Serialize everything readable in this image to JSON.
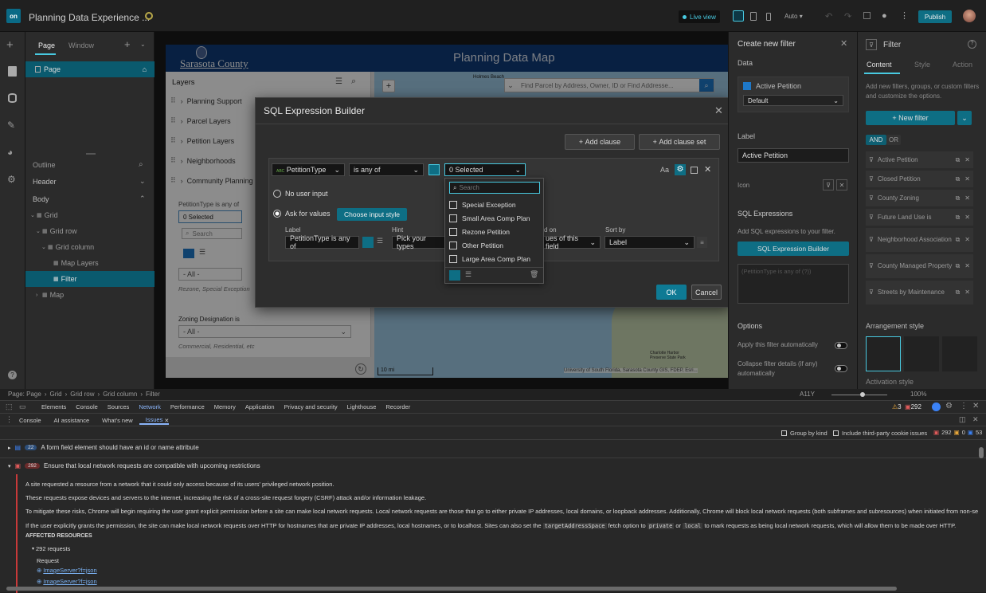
{
  "app": {
    "title": "Planning Data Experience ...",
    "live_view": "Live view",
    "auto": "Auto",
    "publish": "Publish"
  },
  "left": {
    "tabs": [
      "Page",
      "Window"
    ],
    "page_item": "Page",
    "outline": "Outline",
    "header": "Header",
    "body": "Body",
    "tree": [
      {
        "label": "Grid",
        "indent": 0,
        "arrow": "⌄"
      },
      {
        "label": "Grid row",
        "indent": 1,
        "arrow": "⌄"
      },
      {
        "label": "Grid column",
        "indent": 2,
        "arrow": "⌄"
      },
      {
        "label": "Map Layers",
        "indent": 3,
        "arrow": ""
      },
      {
        "label": "Filter",
        "indent": 3,
        "arrow": ""
      },
      {
        "label": "Map",
        "indent": 1,
        "arrow": "›"
      }
    ]
  },
  "map": {
    "org_name": "Sarasota County",
    "title": "Planning Data Map",
    "search_placeholder": "Find Parcel by Address, Owner, ID or Find Addresse...",
    "attribution": "University of South Florida, Sarasota County GIS, FDEP, Esri...",
    "scale": "10 mi",
    "place_holmes": "Holmes Beach",
    "place_charlotte": "Charlotte Harbor Preserve State Park"
  },
  "layers": {
    "title": "Layers",
    "items": [
      "Planning Support",
      "Parcel Layers",
      "Petition Layers",
      "Neighborhoods",
      "Community Planning"
    ],
    "petition_label": "PetitionType is any of",
    "petition_value": "0 Selected",
    "search": "Search",
    "all_value": "- All -",
    "rezone_hint": "Rezone, Special Exception",
    "zoning_label": "Zoning Designation is",
    "zoning_value": "- All -",
    "zoning_hint": "Commercial, Residential, etc"
  },
  "dialog": {
    "title": "SQL Expression Builder",
    "add_clause": "Add clause",
    "add_clause_set": "Add clause set",
    "field": "PetitionType",
    "operator": "is any of",
    "values": "0 Selected",
    "no_user_input": "No user input",
    "ask_for_values": "Ask for values",
    "choose_style": "Choose input style",
    "label_hdr": "Label",
    "hint_hdr": "Hint",
    "based_on_hdr": "d on",
    "sort_hdr": "Sort by",
    "label_value": "PetitionType is any of",
    "hint_value": "Pick your types",
    "based_on_value": "ues of this field",
    "sort_value": "Label",
    "ok": "OK",
    "cancel": "Cancel",
    "dropdown": {
      "search_placeholder": "Search",
      "options": [
        "Special Exception",
        "Small Area Comp Plan",
        "Rezone Petition",
        "Other Petition",
        "Large Area Comp Plan"
      ]
    }
  },
  "filter_panel": {
    "title": "Create new filter",
    "data_hdr": "Data",
    "data_source": "Active Petition",
    "view": "Default",
    "label_hdr": "Label",
    "label_value": "Active Petition",
    "icon_hdr": "Icon",
    "sql_hdr": "SQL Expressions",
    "sql_desc": "Add SQL expressions to your filter.",
    "sql_btn": "SQL Expression Builder",
    "sql_placeholder": "(PetitionType is any of (?))",
    "options_hdr": "Options",
    "opt1": "Apply this filter automatically",
    "opt2": "Collapse filter details (if any) automatically"
  },
  "right": {
    "title": "Filter",
    "tabs": [
      "Content",
      "Style",
      "Action"
    ],
    "desc": "Add new filters, groups, or custom filters and customize the options.",
    "new_filter": "New filter",
    "and": "AND",
    "or": "OR",
    "filters": [
      "Active Petition",
      "Closed Petition",
      "County Zoning",
      "Future Land Use is",
      "Neighborhood Association",
      "County Managed Property",
      "Streets by Maintenance"
    ],
    "arrangement": "Arrangement style",
    "activation": "Activation style"
  },
  "status": {
    "crumbs": [
      "Page: Page",
      "Grid",
      "Grid row",
      "Grid column",
      "Filter"
    ],
    "a11y": "A11Y",
    "zoom": "100%"
  },
  "devtools": {
    "tabs": [
      "Elements",
      "Console",
      "Sources",
      "Network",
      "Performance",
      "Memory",
      "Application",
      "Privacy and security",
      "Lighthouse",
      "Recorder"
    ],
    "warn_count": "3",
    "issue_count": "292",
    "drawer_tabs": [
      "Console",
      "AI assistance",
      "What's new",
      "Issues"
    ],
    "group_by_kind": "Group by kind",
    "third_party": "Include third-party cookie issues",
    "badge_a": "292",
    "badge_b": "0",
    "badge_c": "53",
    "issue1_count": "22",
    "issue1": "A form field element should have an id or name attribute",
    "issue2_count": "292",
    "issue2": "Ensure that local network requests are compatible with upcoming restrictions",
    "p1": "A site requested a resource from a network that it could only access because of its users' privileged network position.",
    "p2": "These requests expose devices and servers to the internet, increasing the risk of a cross-site request forgery (CSRF) attack and/or information leakage.",
    "p3": "To mitigate these risks, Chrome will begin requiring the user grant explicit permission before a site can make local network requests. Local network requests are those that go to either private IP addresses, local domains, or loopback addresses. Additionally, Chrome will block local network requests (both subframes and subresources) when initiated from non-secure",
    "p4a": "If the user explicitly grants the permission, the site can make local network requests over HTTP for hostnames that are private IP addresses, local hostnames, or to localhost. Sites can also set the",
    "p4code1": "targetAddressSpace",
    "p4b": "fetch option to",
    "p4code2": "private",
    "p4c": "or",
    "p4code3": "local",
    "p4d": "to mark requests as being local network requests, which will allow them to be made over HTTP.",
    "affected": "AFFECTED RESOURCES",
    "requests": "292 requests",
    "request_hdr": "Request",
    "req1": "ImageServer?f=json",
    "req2": "ImageServer?f=json"
  }
}
